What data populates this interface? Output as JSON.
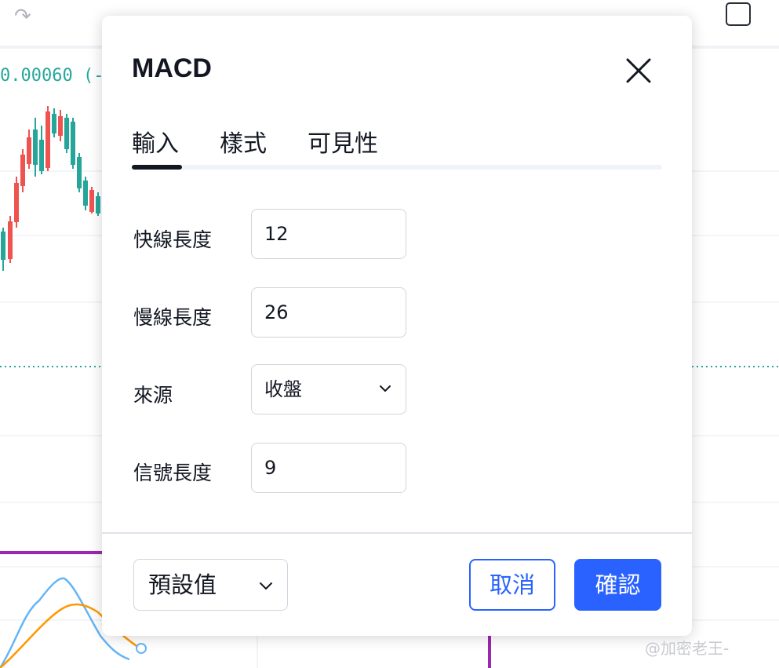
{
  "background": {
    "price_text": "0.00060 (-0.",
    "redo_icon": "redo-arrow-icon",
    "square_icon": "square-icon"
  },
  "dialog": {
    "title": "MACD",
    "close_icon": "close-icon",
    "tabs": [
      {
        "label": "輸入",
        "active": true
      },
      {
        "label": "樣式",
        "active": false
      },
      {
        "label": "可見性",
        "active": false
      }
    ],
    "fields": {
      "fast_length": {
        "label": "快線長度",
        "value": "12"
      },
      "slow_length": {
        "label": "慢線長度",
        "value": "26"
      },
      "source": {
        "label": "來源",
        "value": "收盤"
      },
      "signal_length": {
        "label": "信號長度",
        "value": "9"
      }
    },
    "footer": {
      "defaults_label": "預設值",
      "cancel_label": "取消",
      "confirm_label": "確認"
    }
  },
  "watermark": "@加密老王-",
  "colors": {
    "accent": "#2962ff",
    "up_candle": "#26a69a",
    "down_candle": "#ef5350",
    "macd_line": "#64b5f6",
    "signal_line": "#ff9800",
    "marker_line": "#9c27b0"
  }
}
